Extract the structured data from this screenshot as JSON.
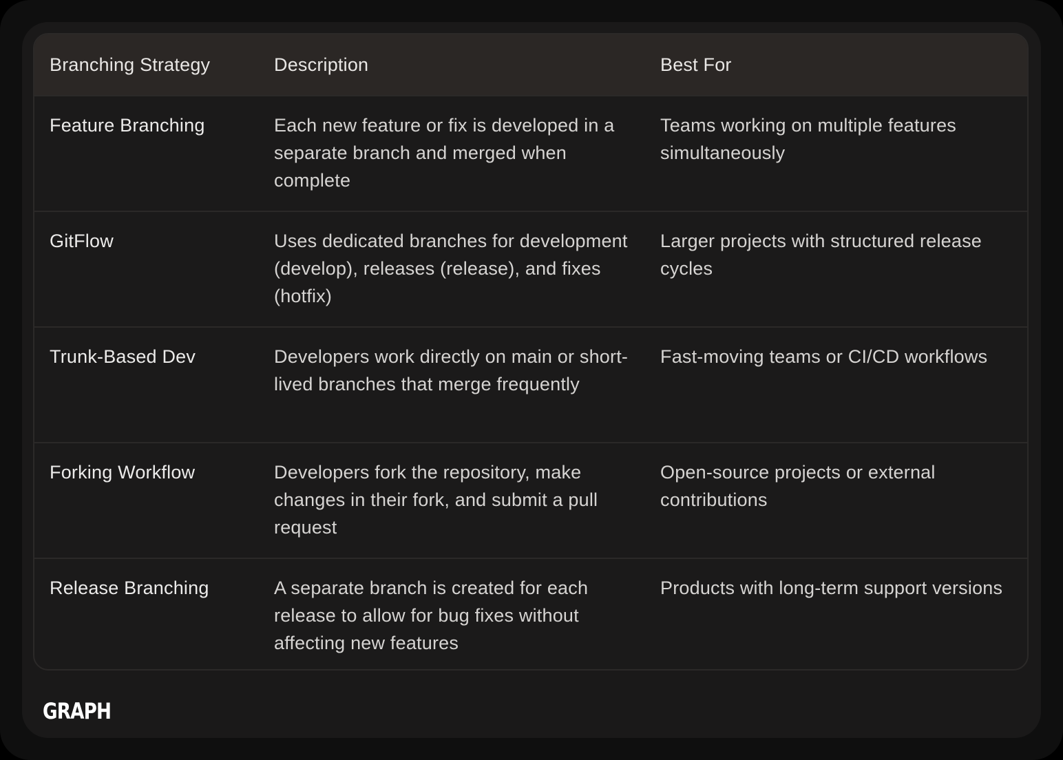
{
  "table": {
    "headers": [
      "Branching Strategy",
      "Description",
      "Best For"
    ],
    "rows": [
      [
        "Feature Branching",
        "Each new feature or fix is developed in a separate branch and merged when complete",
        "Teams working on multiple features simultaneously"
      ],
      [
        "GitFlow",
        "Uses dedicated branches for development (develop), releases (release), and fixes (hotfix)",
        "Larger projects with structured release cycles"
      ],
      [
        "Trunk-Based Dev",
        "Developers work directly on main or short-lived branches that merge frequently",
        "Fast-moving teams or CI/CD workflows"
      ],
      [
        "Forking Workflow",
        "Developers fork the repository, make changes in their fork, and submit a pull request",
        "Open-source projects or external contributions"
      ],
      [
        "Release Branching",
        "A separate branch is created for each release to allow for bug fixes without affecting new features",
        "Products with long-term support versions"
      ]
    ]
  },
  "logo": "GRAPH",
  "colors": {
    "background": "#1a1919",
    "header_background": "#2b2725",
    "border": "#2b2928",
    "text": "#e6e4e2"
  }
}
